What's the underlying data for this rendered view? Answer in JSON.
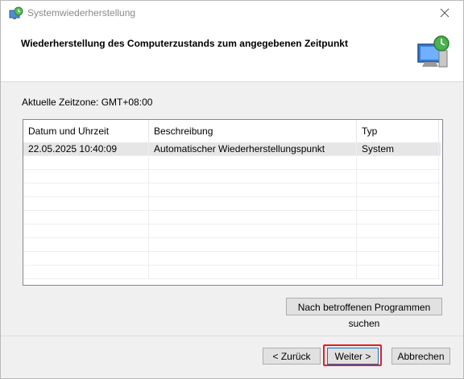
{
  "window": {
    "title": "Systemwiederherstellung",
    "icon": "system-restore-icon",
    "close_icon": "close-icon"
  },
  "header": {
    "title": "Wiederherstellung des Computerzustands zum angegebenen Zeitpunkt",
    "icon": "monitor-restore-icon"
  },
  "timezone_label": "Aktuelle Zeitzone: GMT+08:00",
  "table": {
    "columns": [
      "Datum und Uhrzeit",
      "Beschreibung",
      "Typ"
    ],
    "sorted_column": "Datum und Uhrzeit",
    "rows": [
      {
        "datetime": "22.05.2025 10:40:09",
        "description": "Automatischer Wiederherstellungspunkt",
        "type": "System"
      }
    ]
  },
  "buttons": {
    "scan": "Nach betroffenen Programmen suchen",
    "back": "< Zurück",
    "next": "Weiter >",
    "cancel": "Abbrechen"
  },
  "colors": {
    "highlight": "#e81c24",
    "default_button_border": "#0078d7"
  }
}
